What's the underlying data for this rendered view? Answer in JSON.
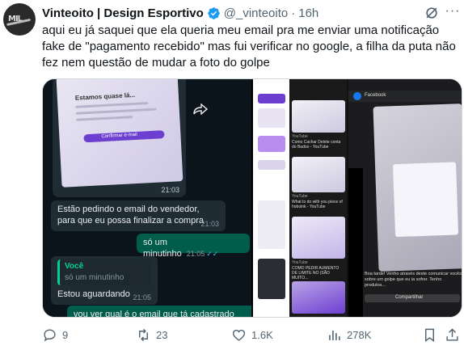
{
  "author": {
    "name": "Vinteoito | Design Esportivo",
    "handle": "@_vinteoito",
    "separator": "·",
    "time": "16h",
    "avatar_text": "MIL"
  },
  "tweet": {
    "text": "aqui eu já saquei que ela queria meu email pra me enviar uma notificação fake de \"pagamento recebido\" mas fui verificar no google, a filha da puta não fez nem questão de mudar a foto do golpe"
  },
  "media": {
    "left": {
      "image_time": "21:03",
      "image_title": "Estamos quase lá...",
      "image_button": "Confirmar e-mail",
      "messages": [
        {
          "text": "Estão pedindo o email do vendedor, para que eu possa finalizar a compra",
          "time": "21:03",
          "dir": "in"
        },
        {
          "text": "só um minutinho",
          "time": "21:05",
          "dir": "out"
        },
        {
          "quote_name": "Você",
          "quote_text": "só um minutinho",
          "text": "Estou aguardando",
          "time": "21:05",
          "dir": "in"
        },
        {
          "text": "vou ver qual é o email que tá cadastrado",
          "dir": "out"
        }
      ]
    },
    "right": {
      "cards": [
        {
          "source": "YouTube",
          "title": "Como Cachar Delete conta do Badoo - YouTube"
        },
        {
          "source": "YouTube",
          "title": "What to do with you piece of hoboink - YouTube"
        },
        {
          "source": "YouTube",
          "title": "COMO PEDIR AUMENTO DE LIMITE NO (SÃO MUITO..."
        }
      ],
      "fb_label": "Facebook",
      "fb_caption": "Boa tarde! Venho através deste comunicar vocês sobre um golpe que eu ia sofrer. Tenho produtos...",
      "fb_share": "Compartilhar"
    }
  },
  "actions": {
    "replies": "9",
    "reposts": "23",
    "likes": "1.6K",
    "views": "278K"
  },
  "colors": {
    "verified": "#1d9bf0",
    "muted": "#536471",
    "wa_out": "#005c4b",
    "wa_in": "#202c33"
  }
}
